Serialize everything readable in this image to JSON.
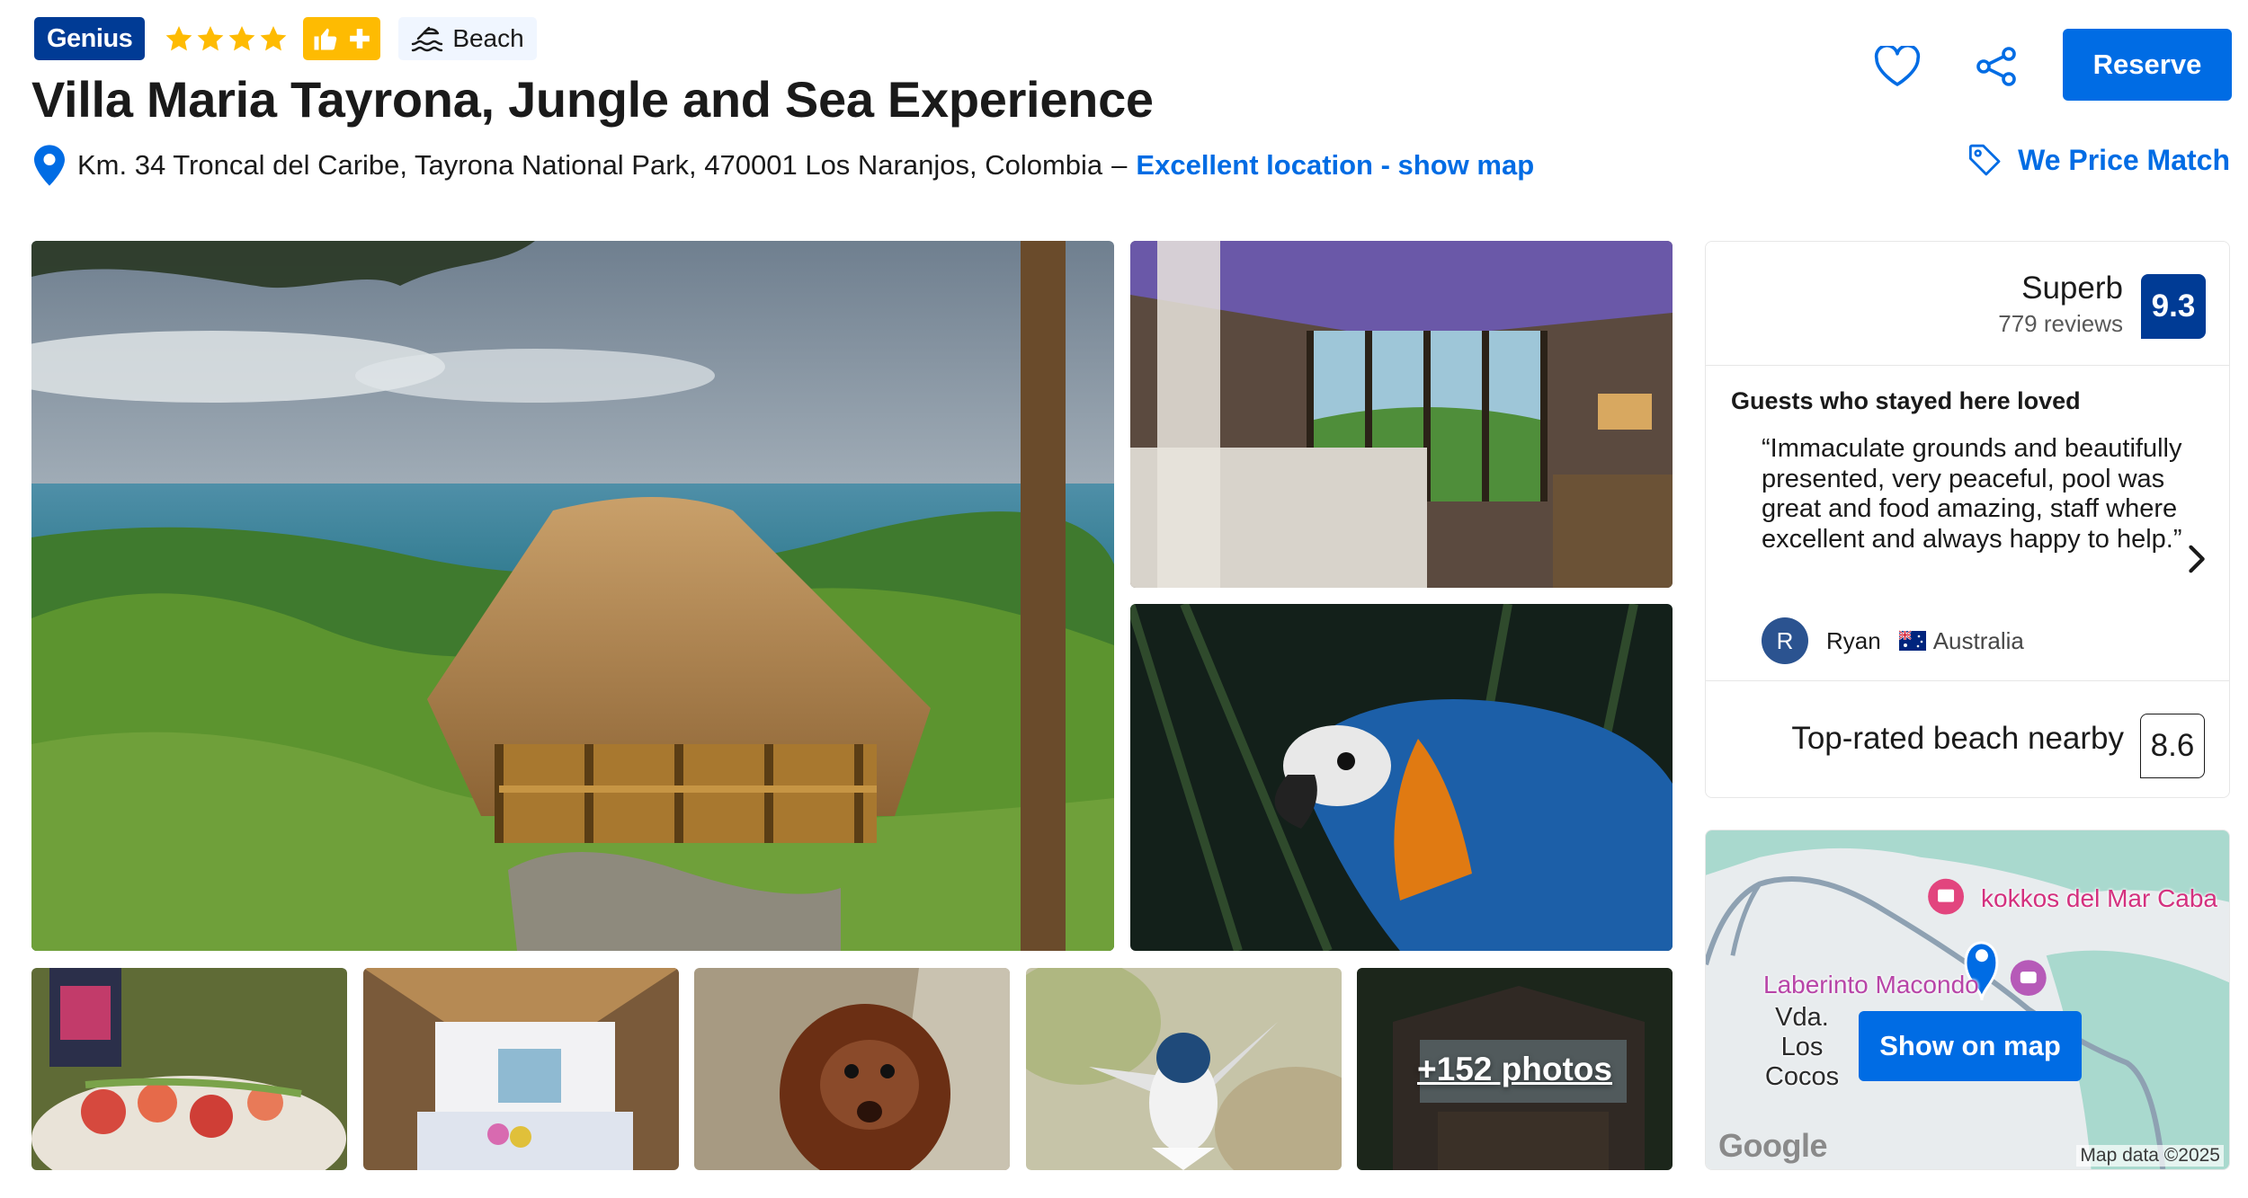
{
  "header": {
    "genius_label": "Genius",
    "star_rating": 4,
    "beach_chip_label": "Beach",
    "title": "Villa Maria Tayrona, Jungle and Sea Experience",
    "address": "Km. 34 Troncal del Caribe, Tayrona National Park, 470001 Los Naranjos, Colombia",
    "address_separator": "–",
    "map_link": "Excellent location - show map",
    "reserve_label": "Reserve",
    "price_match_label": "We Price Match"
  },
  "icons": {
    "location": "location-pin-icon",
    "heart": "heart-icon",
    "share": "share-icon",
    "price_tag": "price-tag-icon",
    "beach": "beach-icon",
    "thumbs_up": "thumbs-up-icon",
    "plus": "plus-icon"
  },
  "colors": {
    "brand_blue": "#003b95",
    "action_blue": "#006ce4",
    "star_yellow": "#febb02"
  },
  "gallery": {
    "more_photos_label": "+152 photos"
  },
  "review_card": {
    "score_word": "Superb",
    "review_count": "779 reviews",
    "score": "9.3",
    "loved_title": "Guests who stayed here loved",
    "quote": "“Immaculate grounds and beautifully presented, very peaceful, pool was great and food amazing, staff where excellent and always happy to help.”",
    "reviewer_initial": "R",
    "reviewer_name": "Ryan",
    "reviewer_country": "Australia",
    "beach_label": "Top-rated beach nearby",
    "beach_score": "8.6"
  },
  "map": {
    "poi_1": "kokkos del Mar Caba",
    "poi_2": "Laberinto Macondo",
    "town": "Vda. Los Cocos",
    "show_on_map_label": "Show on map",
    "provider": "Google",
    "attribution": "Map data ©2025"
  }
}
